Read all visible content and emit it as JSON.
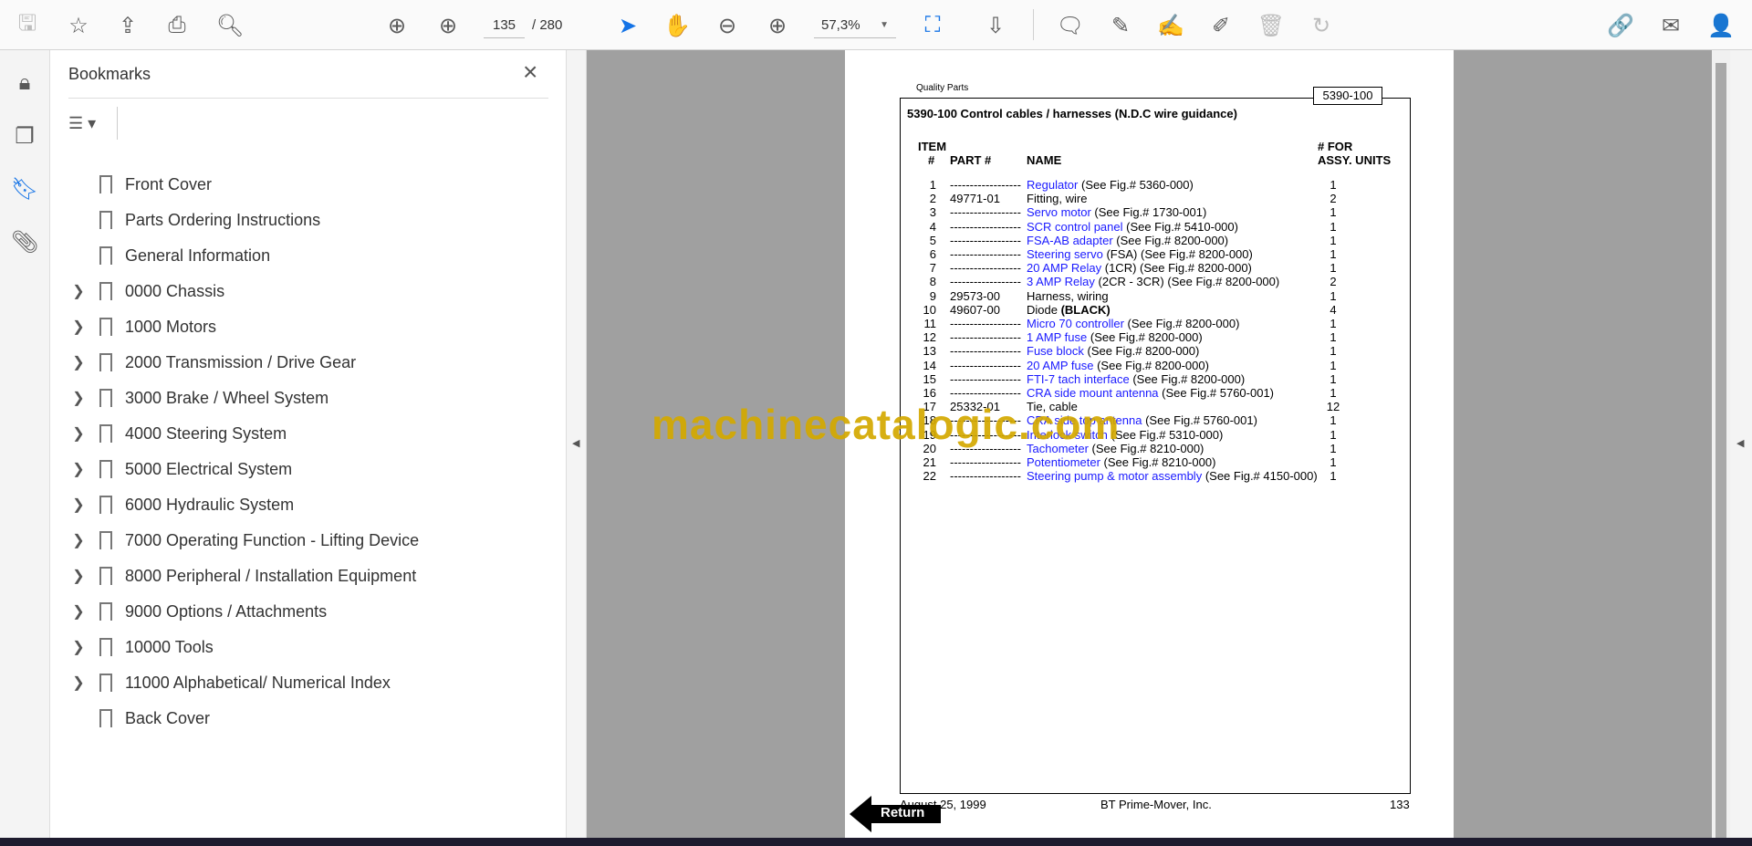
{
  "toolbar": {
    "current_page": "135",
    "page_count_label": "/  280",
    "zoom": "57,3%"
  },
  "bookmarks": {
    "title": "Bookmarks",
    "items": [
      {
        "label": "Front Cover",
        "expandable": false
      },
      {
        "label": "Parts Ordering Instructions",
        "expandable": false
      },
      {
        "label": "General Information",
        "expandable": false
      },
      {
        "label": "0000 Chassis",
        "expandable": true
      },
      {
        "label": "1000 Motors",
        "expandable": true
      },
      {
        "label": "2000 Transmission / Drive Gear",
        "expandable": true
      },
      {
        "label": "3000 Brake / Wheel System",
        "expandable": true
      },
      {
        "label": "4000 Steering System",
        "expandable": true
      },
      {
        "label": "5000 Electrical System",
        "expandable": true
      },
      {
        "label": "6000 Hydraulic System",
        "expandable": true
      },
      {
        "label": "7000 Operating Function - Lifting Device",
        "expandable": true
      },
      {
        "label": "8000 Peripheral / Installation Equipment",
        "expandable": true
      },
      {
        "label": "9000 Options / Attachments",
        "expandable": true
      },
      {
        "label": "10000 Tools",
        "expandable": true
      },
      {
        "label": "11000 Alphabetical/ Numerical Index",
        "expandable": true
      },
      {
        "label": "Back Cover",
        "expandable": false
      }
    ]
  },
  "document": {
    "header_left": "Quality Parts",
    "code": "5390-100",
    "title": "5390-100 Control cables / harnesses (N.D.C wire guidance)",
    "col_item": "ITEM",
    "col_hash": "#",
    "col_part": "PART #",
    "col_name": "NAME",
    "col_for": "# FOR",
    "col_assy": "ASSY. UNITS",
    "rows": [
      {
        "item": "1",
        "part": "------------------",
        "name": "Regulator",
        "ref": " (See Fig.# 5360-000)",
        "qty": "1",
        "link": true
      },
      {
        "item": "2",
        "part": "49771-01",
        "name": "Fitting, wire",
        "ref": "",
        "qty": "2",
        "link": false
      },
      {
        "item": "3",
        "part": "------------------",
        "name": "Servo motor",
        "ref": " (See Fig.# 1730-001)",
        "qty": "1",
        "link": true
      },
      {
        "item": "4",
        "part": "------------------",
        "name": "SCR control panel",
        "ref": " (See Fig.# 5410-000)",
        "qty": "1",
        "link": true
      },
      {
        "item": "5",
        "part": "------------------",
        "name": "FSA-AB adapter",
        "ref": " (See Fig.# 8200-000)",
        "qty": "1",
        "link": true
      },
      {
        "item": "6",
        "part": "------------------",
        "name": "Steering servo",
        "ref": " (FSA) (See Fig.# 8200-000)",
        "qty": "1",
        "link": true
      },
      {
        "item": "7",
        "part": "------------------",
        "name": "20 AMP Relay",
        "ref": " (1CR) (See Fig.# 8200-000)",
        "qty": "1",
        "link": true
      },
      {
        "item": "8",
        "part": "------------------",
        "name": "3 AMP Relay",
        "ref": " (2CR - 3CR) (See Fig.# 8200-000)",
        "qty": "2",
        "link": true
      },
      {
        "item": "9",
        "part": "29573-00",
        "name": "Harness, wiring",
        "ref": "",
        "qty": "1",
        "link": false
      },
      {
        "item": "10",
        "part": "49607-00",
        "name": "Diode ",
        "ref": "(BLACK)",
        "qty": "4",
        "link": false,
        "bold_ref": true
      },
      {
        "item": "11",
        "part": "------------------",
        "name": "Micro 70 controller",
        "ref": " (See Fig.# 8200-000)",
        "qty": "1",
        "link": true
      },
      {
        "item": "12",
        "part": "------------------",
        "name": "1 AMP fuse",
        "ref": " (See Fig.# 8200-000)",
        "qty": "1",
        "link": true
      },
      {
        "item": "13",
        "part": "------------------",
        "name": "Fuse block",
        "ref": " (See Fig.# 8200-000)",
        "qty": "1",
        "link": true
      },
      {
        "item": "14",
        "part": "------------------",
        "name": "20 AMP fuse",
        "ref": " (See Fig.# 8200-000)",
        "qty": "1",
        "link": true
      },
      {
        "item": "15",
        "part": "------------------",
        "name": "FTI-7 tach interface",
        "ref": " (See Fig.# 8200-000)",
        "qty": "1",
        "link": true
      },
      {
        "item": "16",
        "part": "------------------",
        "name": "CRA side mount antenna",
        "ref": " (See Fig.# 5760-001)",
        "qty": "1",
        "link": true
      },
      {
        "item": "17",
        "part": "25332-01",
        "name": "Tie, cable",
        "ref": "",
        "qty": "12",
        "link": false
      },
      {
        "item": "18",
        "part": "------------------",
        "name": "CRA side top antenna",
        "ref": " (See Fig.# 5760-001)",
        "qty": "1",
        "link": true
      },
      {
        "item": "19",
        "part": "------------------",
        "name": "Interlock switch",
        "ref": " (See Fig.# 5310-000)",
        "qty": "1",
        "link": true
      },
      {
        "item": "20",
        "part": "------------------",
        "name": "Tachometer",
        "ref": " (See Fig.# 8210-000)",
        "qty": "1",
        "link": true
      },
      {
        "item": "21",
        "part": "------------------",
        "name": "Potentiometer",
        "ref": " (See Fig.# 8210-000)",
        "qty": "1",
        "link": true
      },
      {
        "item": "22",
        "part": "------------------",
        "name": "Steering pump & motor assembly",
        "ref": " (See Fig.# 4150-000)",
        "qty": "1",
        "link": true
      }
    ],
    "footer_date": "August 25, 1999",
    "footer_company": "BT Prime-Mover, Inc.",
    "footer_page": "133",
    "return_label": "Return"
  },
  "watermark": "machinecatalogic.com"
}
